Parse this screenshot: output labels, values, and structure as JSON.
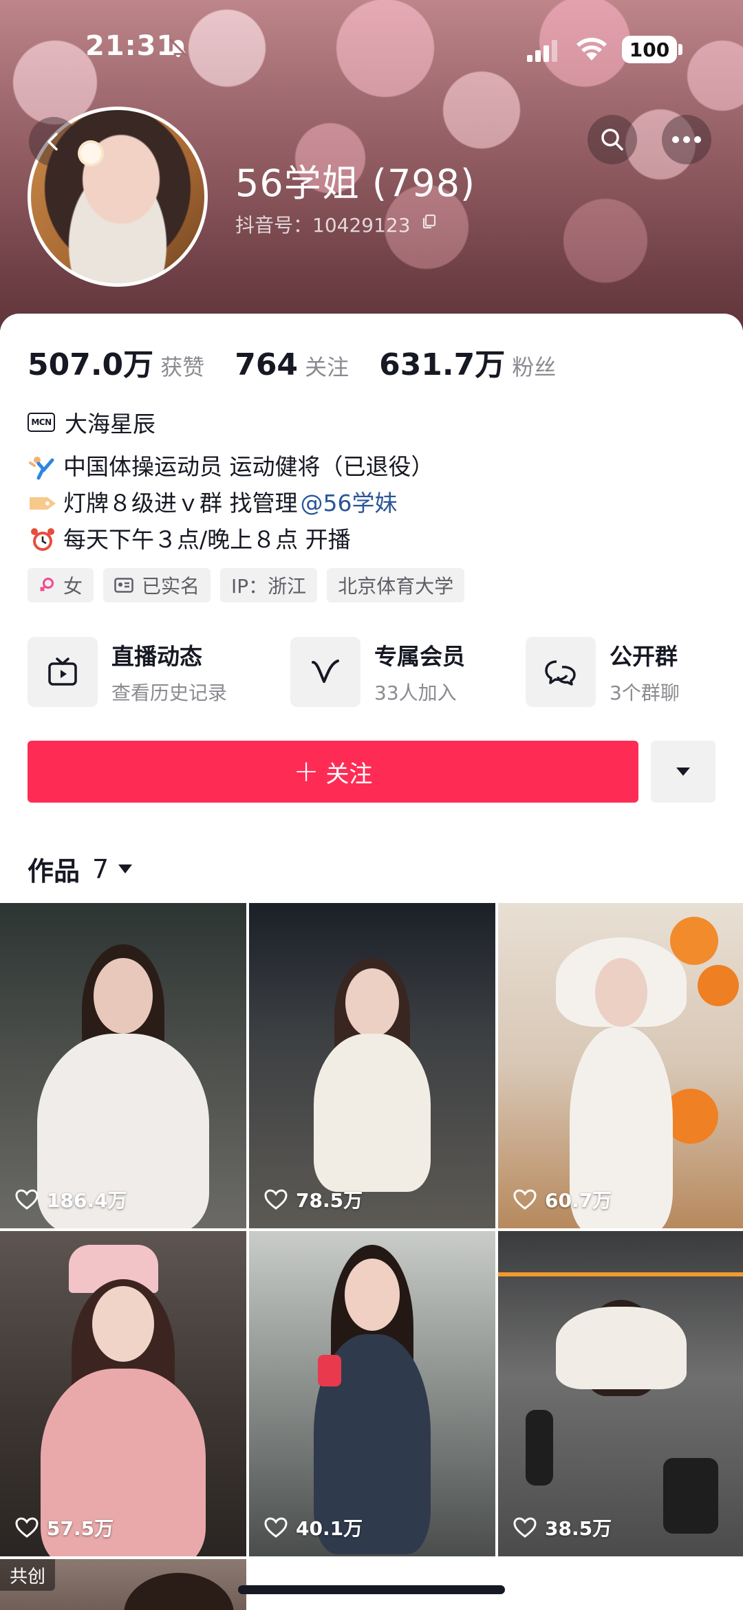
{
  "status_bar": {
    "time": "21:31",
    "battery": "100"
  },
  "profile": {
    "name": "56学姐 (798)",
    "douyin_id": "抖音号：10429123"
  },
  "stats": [
    {
      "value": "507.0万",
      "label": "获赞"
    },
    {
      "value": "764",
      "label": "关注"
    },
    {
      "value": "631.7万",
      "label": "粉丝"
    }
  ],
  "mcn": {
    "badge": "MCN",
    "text": "大海星辰"
  },
  "bio": {
    "line1": "中国体操运动员 运动健将（已退役）",
    "line2_text": "灯牌８级进ｖ群 找管理",
    "line2_mention": "@56学妹",
    "line3": "每天下午３点/晚上８点 开播"
  },
  "tags": [
    "女",
    "已实名",
    "IP：浙江",
    "北京体育大学"
  ],
  "services": [
    {
      "title": "直播动态",
      "sub": "查看历史记录",
      "icon": "tv-icon"
    },
    {
      "title": "专属会员",
      "sub": "33人加入",
      "icon": "v-icon"
    },
    {
      "title": "公开群",
      "sub": "3个群聊",
      "icon": "chat-icon"
    }
  ],
  "follow_button": {
    "label": "关注"
  },
  "works": {
    "label": "作品",
    "count": "7"
  },
  "videos": [
    {
      "likes": "186.4万"
    },
    {
      "likes": "78.5万"
    },
    {
      "likes": "60.7万"
    },
    {
      "likes": "57.5万"
    },
    {
      "likes": "40.1万"
    },
    {
      "likes": "38.5万"
    },
    {
      "badge": "共创"
    }
  ],
  "colors": {
    "accent": "#fe2c55",
    "mention": "#2a5597",
    "text": "#161823",
    "muted": "#8a8b91"
  }
}
